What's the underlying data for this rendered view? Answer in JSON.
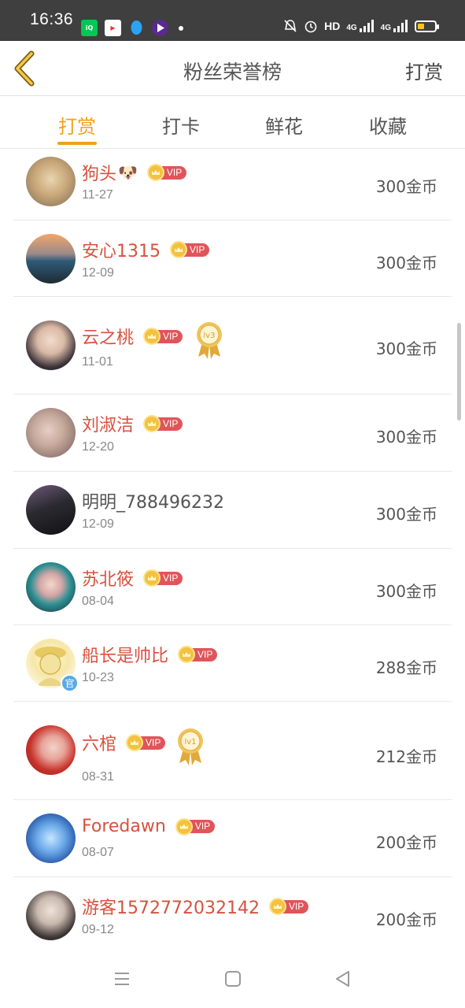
{
  "status_bar": {
    "time": "16:36",
    "apps": [
      "iqiyi-icon",
      "tencent-video-icon",
      "qq-icon",
      "video-app-icon"
    ],
    "right_icons": [
      "mute-icon",
      "alarm-icon"
    ],
    "hd": "HD",
    "net1": "4G",
    "net2": "4G"
  },
  "nav": {
    "title": "粉丝荣誉榜",
    "action": "打赏"
  },
  "tabs": [
    {
      "label": "打赏",
      "active": true
    },
    {
      "label": "打卡",
      "active": false
    },
    {
      "label": "鲜花",
      "active": false
    },
    {
      "label": "收藏",
      "active": false
    }
  ],
  "vip_label": "VIP",
  "rows": [
    {
      "name": "狗头",
      "emoji": "🐶",
      "vip": true,
      "medal": "",
      "date": "11-27",
      "amount": "300金币"
    },
    {
      "name": "安心1315",
      "vip": true,
      "medal": "",
      "date": "12-09",
      "amount": "300金币"
    },
    {
      "name": "云之桃",
      "vip": true,
      "medal": "lv3",
      "date": "11-01",
      "amount": "300金币"
    },
    {
      "name": "刘淑洁",
      "vip": true,
      "medal": "",
      "date": "12-20",
      "amount": "300金币"
    },
    {
      "name": "明明_788496232",
      "vip": false,
      "medal": "",
      "date": "12-09",
      "amount": "300金币"
    },
    {
      "name": "苏北筱",
      "vip": true,
      "medal": "",
      "date": "08-04",
      "amount": "300金币"
    },
    {
      "name": "船长是帅比",
      "vip": true,
      "medal": "",
      "date": "10-23",
      "amount": "288金币",
      "badge": "官"
    },
    {
      "name": "六棺",
      "vip": true,
      "medal": "lv1",
      "date": "08-31",
      "amount": "212金币"
    },
    {
      "name": "Foredawn",
      "vip": true,
      "medal": "",
      "date": "08-07",
      "amount": "200金币"
    },
    {
      "name": "游客1572772032142",
      "vip": true,
      "medal": "",
      "date": "09-12",
      "amount": "200金币"
    }
  ],
  "colors": {
    "accent": "#f0a11a",
    "vip_name": "#d8513f",
    "vip_tag": "#e0555a"
  }
}
